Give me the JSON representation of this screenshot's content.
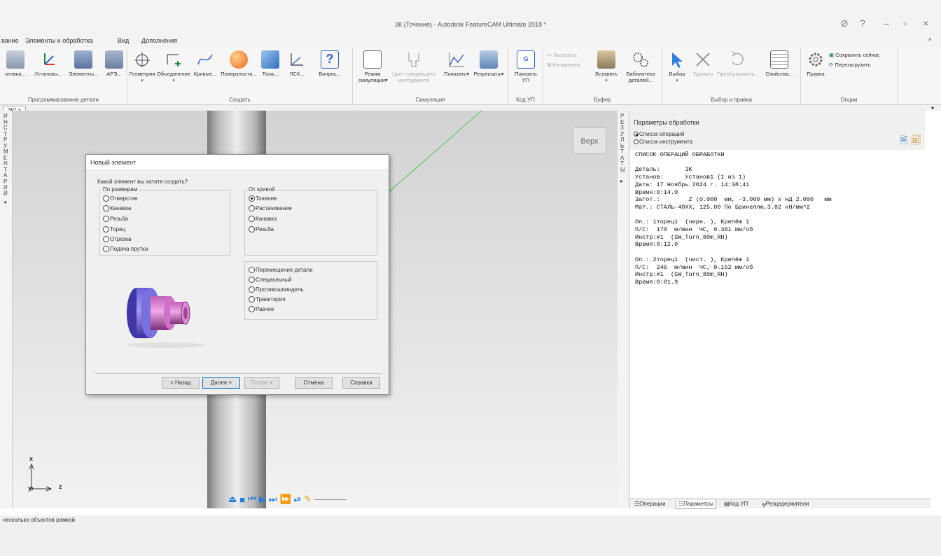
{
  "window": {
    "title": "3К (Точение) - Autodesk FeatureCAM Ultimate 2018 *"
  },
  "menu": [
    "вание",
    "Элементы и обработка",
    "Вид",
    "Дополнения"
  ],
  "ribbon": {
    "groups": [
      {
        "label": "Программирование детали",
        "buttons": [
          "отовка...",
          "Установы...",
          "Элементы...",
          "АРЭ..."
        ]
      },
      {
        "label": "Создать",
        "buttons": [
          "Геометрия",
          "Объединение",
          "Кривые...",
          "Поверхности...",
          "Тела...",
          "ЛСК...",
          "Вопрос..."
        ]
      },
      {
        "label": "Симуляция",
        "buttons": [
          "Режим симуляции",
          "Цвет следующего инструмента",
          "Показать",
          "Результаты"
        ]
      },
      {
        "label": "Код УП",
        "buttons": [
          "Показать УП"
        ]
      },
      {
        "label": "Буфер",
        "buttons": [
          "Вырезать",
          "Копировать",
          "Вставить",
          "Библиотека деталей..."
        ]
      },
      {
        "label": "Выбор и правка",
        "buttons": [
          "Выбор",
          "Удалить",
          "Преобразовать...",
          "Свойства..."
        ]
      },
      {
        "label": "Опции",
        "buttons": [
          "Правка",
          "Сохранить сейчас",
          "Перезагрузить"
        ]
      }
    ]
  },
  "doc_tab": "3К*",
  "left_strip": "ИНСТРУМЕНТАРИЙ",
  "mid_strip": "РЕЗУЛЬТАТЫ",
  "viewport": {
    "view_label": "Верх",
    "axis_x": "x",
    "axis_y": "y",
    "axis_z": "z"
  },
  "dialog": {
    "title": "Новый элемент",
    "question": "Какой элемент вы хотите создать?",
    "group_size": {
      "label": "По размерам",
      "options": [
        "Отверстие",
        "Канавка",
        "Резьба",
        "Торец",
        "Отрезка",
        "Подача прутка"
      ]
    },
    "group_curve": {
      "label": "От кривой",
      "options": [
        "Точение",
        "Растачивание",
        "Канавка",
        "Резьба"
      ],
      "selected": "Точение"
    },
    "group_other": {
      "options": [
        "Перемещение детали",
        "Специальный",
        "Противошпиндель",
        "Траектория",
        "Разное"
      ]
    },
    "buttons": {
      "back": "< Назад",
      "next": "Далее >",
      "finish": "Готово",
      "cancel": "Отмена",
      "help": "Справка"
    }
  },
  "right_panel": {
    "title": "Параметры обработки",
    "radio_ops": "Список операций",
    "radio_tools": "Список инструмента",
    "lines": [
      "СПИСОК ОПЕРАЦИЙ ОБРАБОТКИ",
      "",
      "Деталь:       3К",
      "Установ:      Установ1 (1 из 1)",
      "Дата: 17 Ноябрь 2024 г. 14:38:41",
      "Время:0:14.0",
      "Загот.:        Z (0.000  мм, -3.000 мм) х НД 2.000   мм",
      "Мат.: СТАЛЬ-40ХХ, 125.00 По Бринеллю,3.82 кН/мм^2",
      "",
      "Оп.: 1торец1  (черн. ), Крепёж 1",
      "П/С:  170  м/мин  ЧС, 0.381 мм/об",
      "Инстр:#1  (SW_Turn_80m_RH)",
      "Время:0:12.0",
      "",
      "Оп.: 2торец1  (чист. ), Крепёж 1",
      "П/С:  246  м/мин  ЧС, 0.152 мм/об",
      "Инстр:#1  (SW_Turn_80m_RH)",
      "Время:0:01.9"
    ],
    "tabs": [
      "Операции",
      "Параметры",
      "Код УП",
      "Резцедержатели"
    ]
  },
  "status": "несколько объектов рамкой"
}
